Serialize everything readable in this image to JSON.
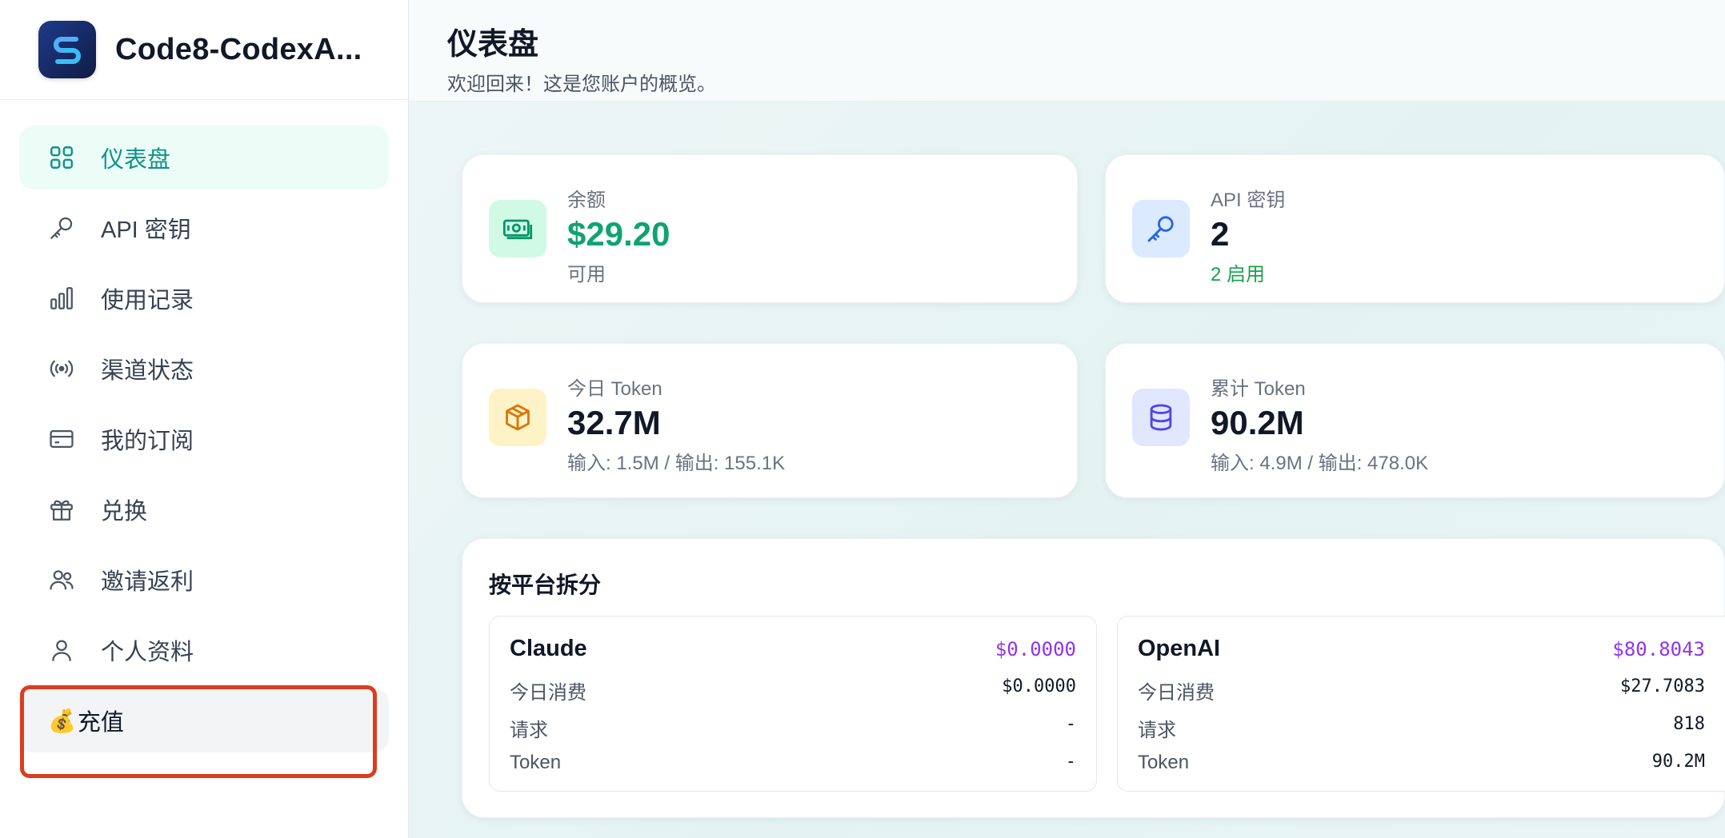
{
  "sidebar": {
    "brand": "Code8-CodexA...",
    "items": [
      {
        "label": "仪表盘",
        "icon": "grid-icon"
      },
      {
        "label": "API 密钥",
        "icon": "key-icon"
      },
      {
        "label": "使用记录",
        "icon": "bar-chart-icon"
      },
      {
        "label": "渠道状态",
        "icon": "broadcast-icon"
      },
      {
        "label": "我的订阅",
        "icon": "credit-card-icon"
      },
      {
        "label": "兑换",
        "icon": "gift-icon"
      },
      {
        "label": "邀请返利",
        "icon": "users-icon"
      },
      {
        "label": "个人资料",
        "icon": "user-icon"
      }
    ],
    "topup": {
      "emoji": "💰",
      "label": "充值"
    }
  },
  "header": {
    "title": "仪表盘",
    "subtitle": "欢迎回来！这是您账户的概览。"
  },
  "stats": {
    "balance": {
      "label": "余额",
      "value": "$29.20",
      "sub": "可用"
    },
    "api_keys": {
      "label": "API 密钥",
      "value": "2",
      "sub": "2 启用"
    },
    "today_token": {
      "label": "今日 Token",
      "value": "32.7M",
      "sub": "输入: 1.5M / 输出: 155.1K"
    },
    "total_token": {
      "label": "累计 Token",
      "value": "90.2M",
      "sub": "输入: 4.9M / 输出: 478.0K"
    }
  },
  "platforms": {
    "title": "按平台拆分",
    "row_labels": {
      "today": "今日消费",
      "requests": "请求",
      "token": "Token"
    },
    "claude": {
      "name": "Claude",
      "cost": "$0.0000",
      "today": "$0.0000",
      "requests": "-",
      "token": "-"
    },
    "openai": {
      "name": "OpenAI",
      "cost": "$80.8043",
      "today": "$27.7083",
      "requests": "818",
      "token": "90.2M"
    }
  },
  "colors": {
    "accent": "#0d9488",
    "highlight": "#dc3d1e",
    "purple": "#9333ea",
    "green": "#10a36f"
  }
}
